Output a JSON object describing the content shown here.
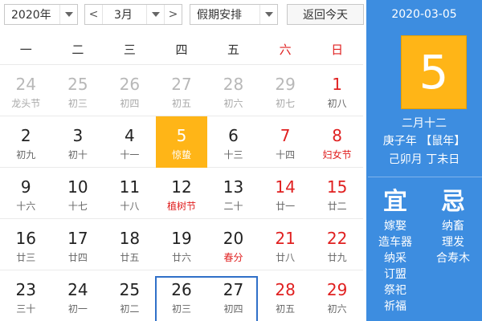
{
  "toolbar": {
    "year": "2020年",
    "month": "3月",
    "prev": "<",
    "next": ">",
    "holiday": "假期安排",
    "today_button": "返回今天"
  },
  "weekdays": [
    "一",
    "二",
    "三",
    "四",
    "五",
    "六",
    "日"
  ],
  "weeks": [
    [
      {
        "day": "24",
        "lunar": "龙头节"
      },
      {
        "day": "25",
        "lunar": "初三"
      },
      {
        "day": "26",
        "lunar": "初四"
      },
      {
        "day": "27",
        "lunar": "初五"
      },
      {
        "day": "28",
        "lunar": "初六"
      },
      {
        "day": "29",
        "lunar": "初七"
      },
      {
        "day": "1",
        "lunar": "初八"
      }
    ],
    [
      {
        "day": "2",
        "lunar": "初九"
      },
      {
        "day": "3",
        "lunar": "初十"
      },
      {
        "day": "4",
        "lunar": "十一"
      },
      {
        "day": "5",
        "lunar": "惊蛰"
      },
      {
        "day": "6",
        "lunar": "十三"
      },
      {
        "day": "7",
        "lunar": "十四"
      },
      {
        "day": "8",
        "lunar": "妇女节"
      }
    ],
    [
      {
        "day": "9",
        "lunar": "十六"
      },
      {
        "day": "10",
        "lunar": "十七"
      },
      {
        "day": "11",
        "lunar": "十八"
      },
      {
        "day": "12",
        "lunar": "植树节"
      },
      {
        "day": "13",
        "lunar": "二十"
      },
      {
        "day": "14",
        "lunar": "廿一"
      },
      {
        "day": "15",
        "lunar": "廿二"
      }
    ],
    [
      {
        "day": "16",
        "lunar": "廿三"
      },
      {
        "day": "17",
        "lunar": "廿四"
      },
      {
        "day": "18",
        "lunar": "廿五"
      },
      {
        "day": "19",
        "lunar": "廿六"
      },
      {
        "day": "20",
        "lunar": "春分"
      },
      {
        "day": "21",
        "lunar": "廿八"
      },
      {
        "day": "22",
        "lunar": "廿九"
      }
    ],
    [
      {
        "day": "23",
        "lunar": "三十"
      },
      {
        "day": "24",
        "lunar": "初一"
      },
      {
        "day": "25",
        "lunar": "初二"
      },
      {
        "day": "26",
        "lunar": "初三"
      },
      {
        "day": "27",
        "lunar": "初四"
      },
      {
        "day": "28",
        "lunar": "初五"
      },
      {
        "day": "29",
        "lunar": "初六"
      }
    ]
  ],
  "panel": {
    "date": "2020-03-05",
    "big_day": "5",
    "lunar_date": "二月十二",
    "ganzhi_year": "庚子年 【鼠年】",
    "ganzhi_month_day": "己卯月 丁未日",
    "yi_title": "宜",
    "ji_title": "忌",
    "yi_items": [
      "嫁娶",
      "造车器",
      "纳采",
      "订盟",
      "祭祀",
      "祈福"
    ],
    "ji_items": [
      "纳畜",
      "理发",
      "合寿木"
    ]
  },
  "colors": {
    "accent_blue": "#3d8de0",
    "today_orange": "#ffb517",
    "weekend_red": "#e02020",
    "selection_border": "#3070c8"
  }
}
